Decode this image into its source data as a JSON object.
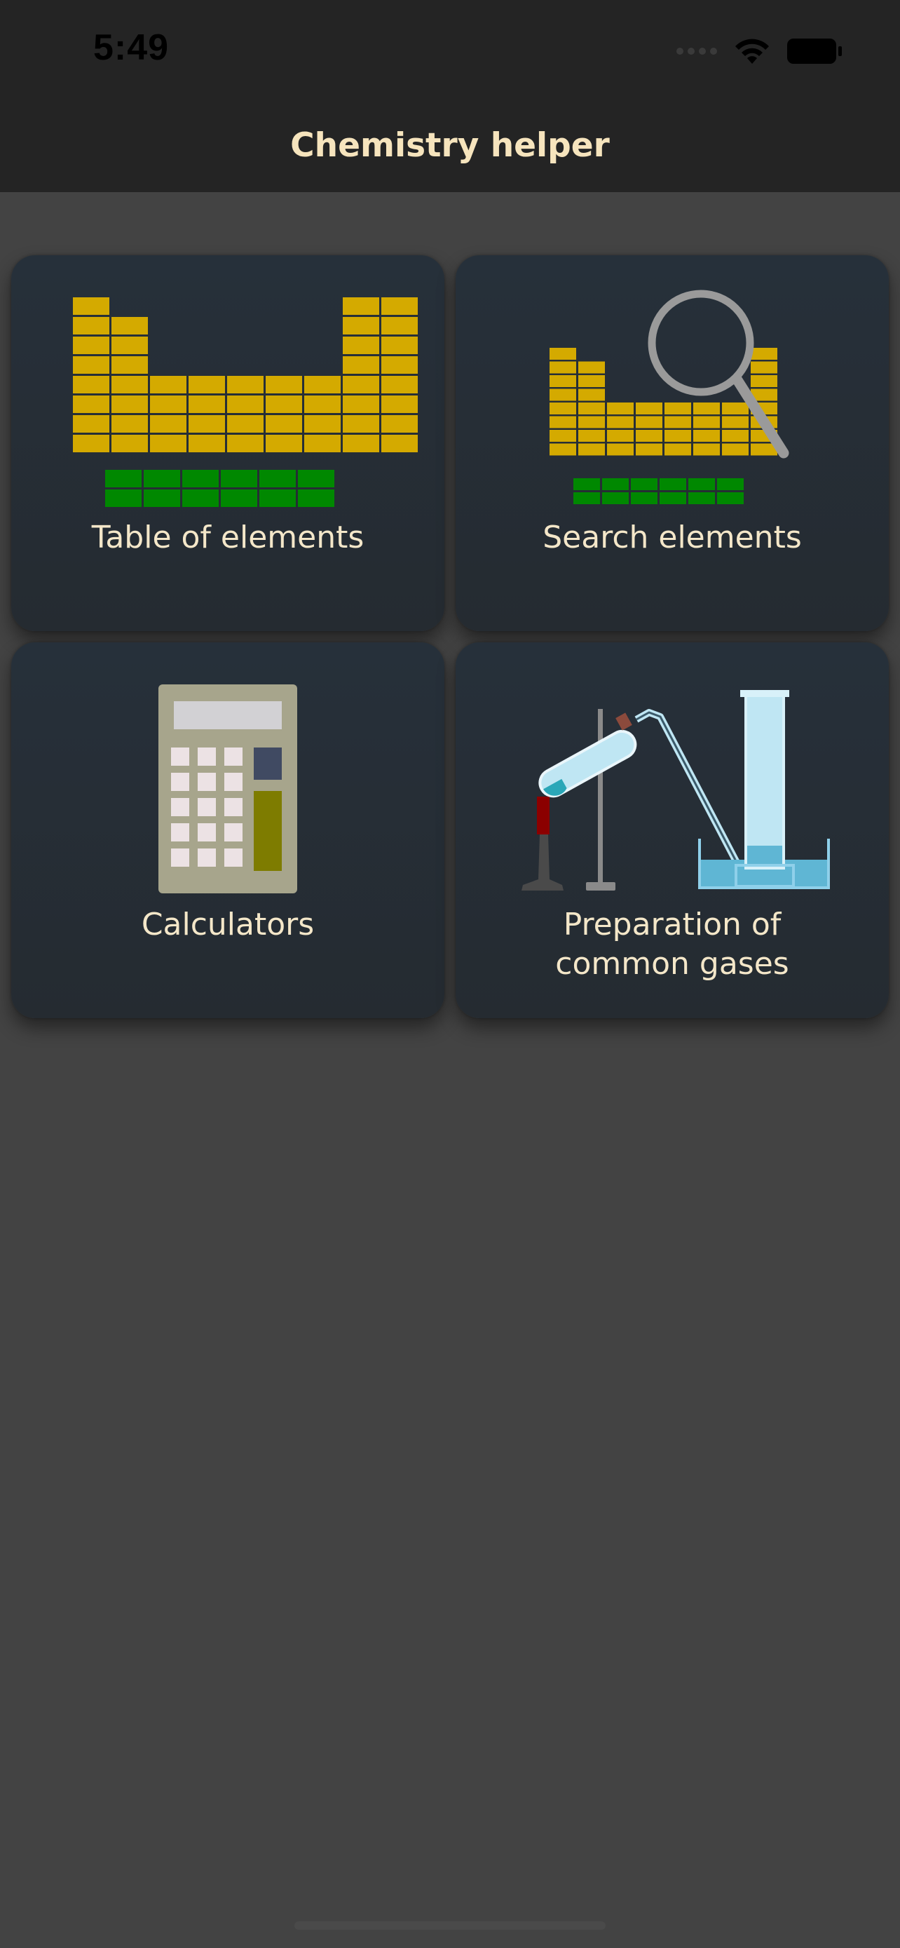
{
  "status_bar": {
    "time": "5:49",
    "icons": [
      "signal-icon",
      "wifi-icon",
      "battery-icon"
    ]
  },
  "nav": {
    "title": "Chemistry helper"
  },
  "colors": {
    "background": "#434343",
    "bar": "#242424",
    "card": "#26303a",
    "title_text": "#f6e4bd",
    "label_text": "#f4e7c9",
    "element_block": "#d4aa00",
    "lanthanide_block": "#008800"
  },
  "cards": [
    {
      "label": "Table of elements",
      "icon": "periodic-table-icon"
    },
    {
      "label": "Search elements",
      "icon": "search-elements-icon"
    },
    {
      "label": "Calculators",
      "icon": "calculator-icon"
    },
    {
      "label": "Preparation of\ncommon gases",
      "label_lines": [
        "Preparation of",
        "common gases"
      ],
      "icon": "gas-apparatus-icon"
    }
  ]
}
